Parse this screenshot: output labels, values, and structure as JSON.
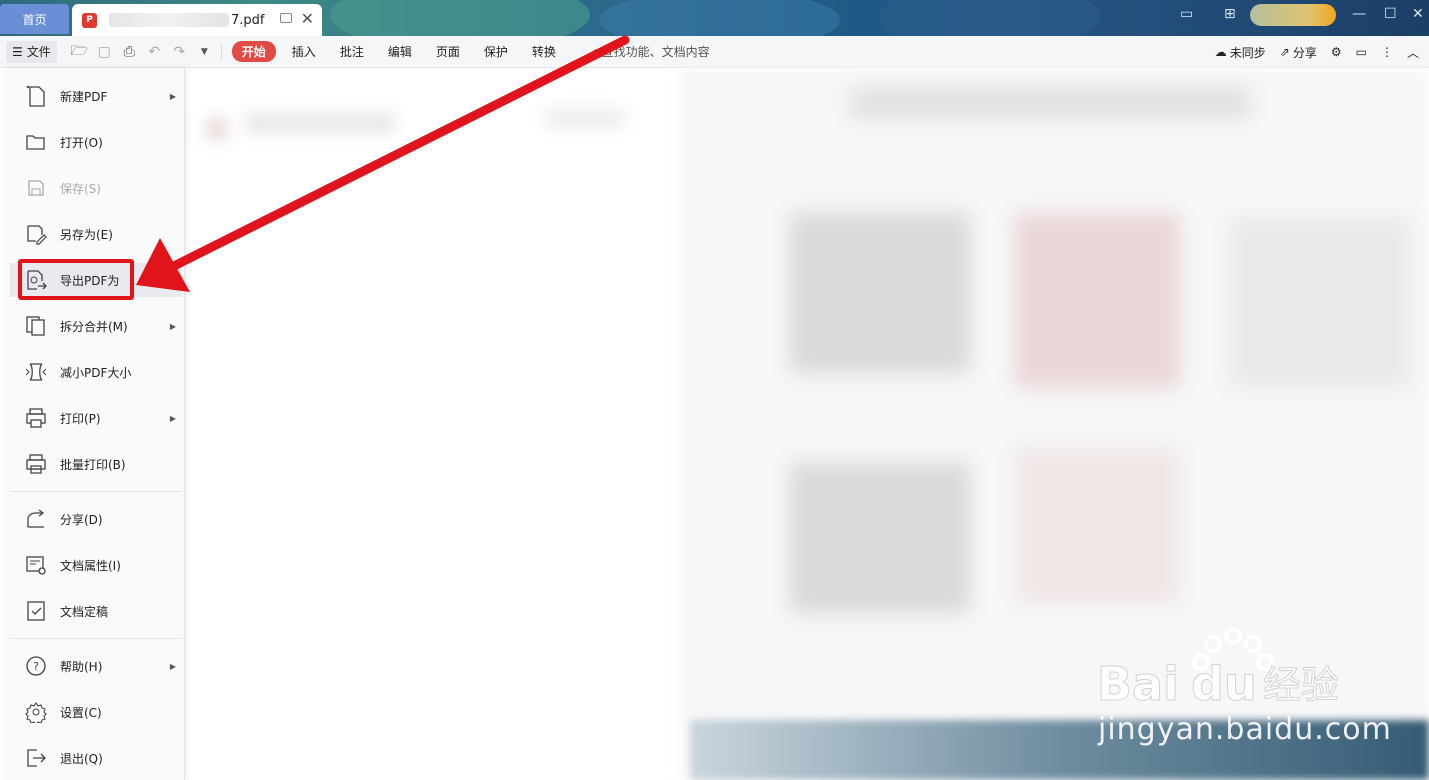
{
  "titlebar": {
    "home_tab": "首页",
    "doc_tab": {
      "name": "7.pdf",
      "close": "✕"
    },
    "window_controls": [
      "—",
      "☐"
    ]
  },
  "toolbar": {
    "file_label": "文件",
    "tabs": [
      {
        "label": "开始",
        "active": true
      },
      {
        "label": "插入"
      },
      {
        "label": "批注"
      },
      {
        "label": "编辑"
      },
      {
        "label": "页面"
      },
      {
        "label": "保护"
      },
      {
        "label": "转换"
      }
    ],
    "search_placeholder": "查找功能、文档内容",
    "sync_label": "未同步",
    "share_label": "分享"
  },
  "file_menu": {
    "items": [
      {
        "label": "新建PDF",
        "icon": "new-file-icon",
        "submenu": true
      },
      {
        "label": "打开(O)",
        "icon": "folder-open-icon"
      },
      {
        "label": "保存(S)",
        "icon": "save-icon",
        "disabled": true
      },
      {
        "label": "另存为(E)",
        "icon": "save-as-icon"
      },
      {
        "label": "导出PDF为",
        "icon": "export-icon",
        "highlighted": true
      },
      {
        "label": "拆分合并(M)",
        "icon": "split-merge-icon",
        "submenu": true
      },
      {
        "label": "减小PDF大小",
        "icon": "compress-icon"
      },
      {
        "label": "打印(P)",
        "icon": "print-icon",
        "submenu": true
      },
      {
        "label": "批量打印(B)",
        "icon": "batch-print-icon"
      },
      {
        "label": "分享(D)",
        "icon": "share-icon"
      },
      {
        "label": "文档属性(I)",
        "icon": "doc-properties-icon"
      },
      {
        "label": "文档定稿",
        "icon": "finalize-icon"
      },
      {
        "label": "帮助(H)",
        "icon": "help-icon",
        "submenu": true
      },
      {
        "label": "设置(C)",
        "icon": "settings-icon"
      },
      {
        "label": "退出(Q)",
        "icon": "exit-icon"
      }
    ]
  },
  "watermark": {
    "brand": "Bai du 经验",
    "url": "jingyan.baidu.com"
  },
  "colors": {
    "accent": "#e04b46",
    "annotation": "#e1141b",
    "home_tab": "#6b8fd6"
  }
}
